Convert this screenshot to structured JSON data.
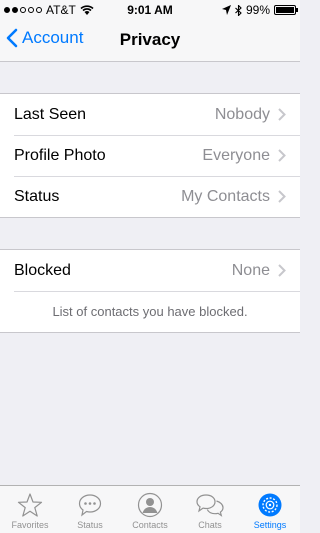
{
  "status": {
    "carrier": "AT&T",
    "time": "9:01 AM",
    "battery": "99%",
    "battery_level": 0.99
  },
  "nav": {
    "back_label": "Account",
    "title": "Privacy"
  },
  "privacy": [
    {
      "label": "Last Seen",
      "value": "Nobody"
    },
    {
      "label": "Profile Photo",
      "value": "Everyone"
    },
    {
      "label": "Status",
      "value": "My Contacts"
    }
  ],
  "blocked": {
    "label": "Blocked",
    "value": "None",
    "footnote": "List of contacts you have blocked."
  },
  "tabs": [
    {
      "label": "Favorites",
      "icon": "star-icon"
    },
    {
      "label": "Status",
      "icon": "speech-bubble-icon"
    },
    {
      "label": "Contacts",
      "icon": "person-icon"
    },
    {
      "label": "Chats",
      "icon": "chat-bubbles-icon"
    },
    {
      "label": "Settings",
      "icon": "gear-icon",
      "active": true
    }
  ],
  "colors": {
    "accent": "#007aff",
    "background": "#efeff4",
    "secondary_text": "#8e8e93"
  }
}
